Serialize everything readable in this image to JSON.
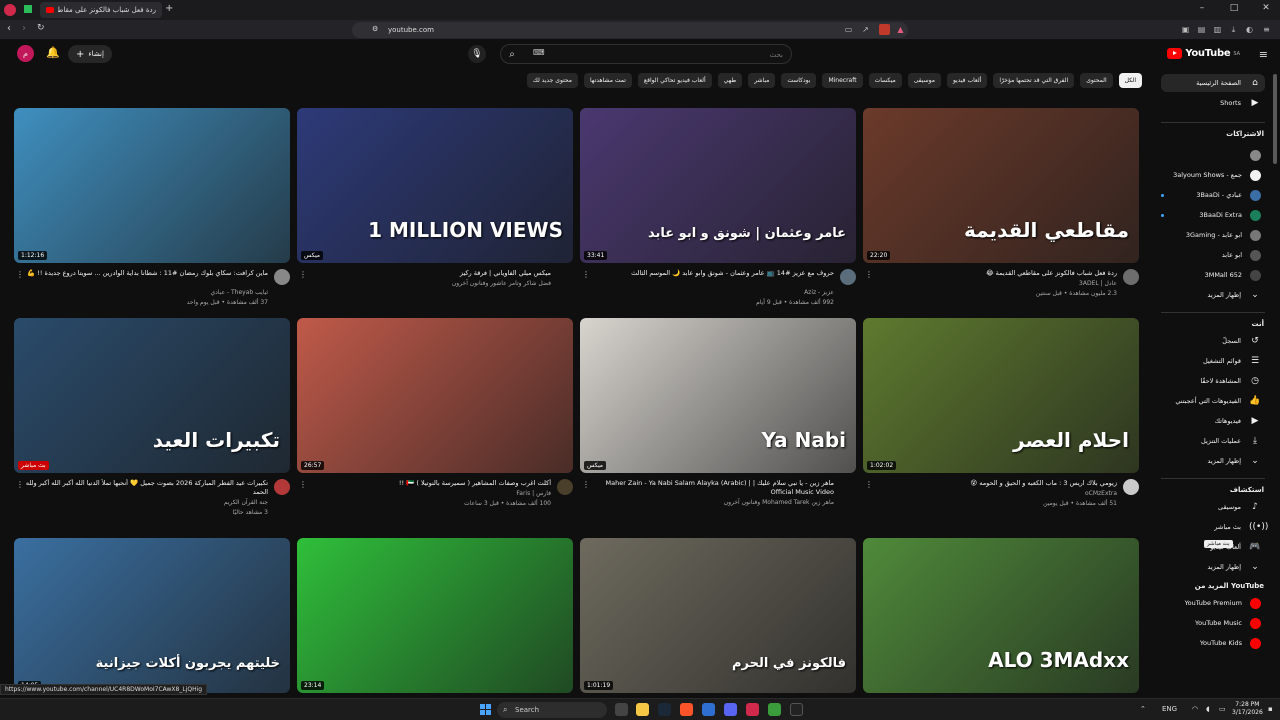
{
  "browser": {
    "tabs": [
      {
        "title": "ردة فعل شباب فالكونز على مقاطعي ا",
        "active": true
      }
    ],
    "url": "youtube.com",
    "new_tab": "+"
  },
  "header": {
    "logo_text": "YouTube",
    "logo_region": "SA",
    "search_placeholder": "بحث",
    "create_label": "إنشاء",
    "avatar_letter": "م"
  },
  "chips": [
    "الكل",
    "المحتوى",
    "الفرق التي قد تحتمها مؤخرًا",
    "ألعاب فيديو",
    "موسيقى",
    "ميكسات",
    "Minecraft",
    "بودكاست",
    "مباشر",
    "طهي",
    "ألعاب فيديو تحاكي الواقع",
    "تمت مشاهدتها",
    "محتوى جديد لك"
  ],
  "sidebar": {
    "main": [
      {
        "label": "الصفحة الرئيسية",
        "icon": "home-icon",
        "active": true
      },
      {
        "label": "Shorts",
        "icon": "shorts-icon",
        "active": false
      }
    ],
    "subscriptions_title": "الاشتراكات",
    "subscriptions": [
      {
        "label": "",
        "color": "#888888",
        "dot": false
      },
      {
        "label": "3alyoum Shows - جمع",
        "color": "#f2f2f2",
        "dot": false
      },
      {
        "label": "3BaaDi - عبادي",
        "color": "#3b6ea5",
        "dot": true
      },
      {
        "label": "3BaaDi Extra",
        "color": "#1a7f5a",
        "dot": true
      },
      {
        "label": "3Gaming - ابو عابد",
        "color": "#777777",
        "dot": false
      },
      {
        "label": "ابو عابد",
        "color": "#555555",
        "dot": false
      },
      {
        "label": "3MMall 652",
        "color": "#444444",
        "dot": false
      }
    ],
    "subs_more": "إظهار المزيد",
    "you_title": "أنت",
    "you": [
      {
        "label": "السجلّ",
        "icon": "history-icon"
      },
      {
        "label": "قوائم التشغيل",
        "icon": "playlists-icon"
      },
      {
        "label": "المشاهدة لاحقًا",
        "icon": "watch-later-icon"
      },
      {
        "label": "الفيديوهات التي أعجبتني",
        "icon": "like-icon"
      },
      {
        "label": "فيديوهاتك",
        "icon": "your-videos-icon"
      },
      {
        "label": "عمليات التنزيل",
        "icon": "download-icon"
      }
    ],
    "you_more": "إظهار المزيد",
    "explore_title": "استكشاف",
    "explore": [
      {
        "label": "موسيقى",
        "icon": "music-icon"
      },
      {
        "label": "بث مباشر",
        "icon": "live-icon"
      },
      {
        "label": "ألعاب فيديو",
        "icon": "gaming-icon"
      }
    ],
    "explore_more": "إظهار المزيد",
    "more_title": "المزيد من YouTube",
    "more": [
      {
        "label": "YouTube Premium",
        "color": "#ff0000"
      },
      {
        "label": "YouTube Music",
        "color": "#ff0000"
      },
      {
        "label": "YouTube Kids",
        "color": "#ff0000"
      }
    ],
    "tooltip": "بث مباشر"
  },
  "videos": [
    {
      "title": "ردة فعل شباب فالكونز على مقاطعي القديمة 😂",
      "channel": "عادل | 3ADEL",
      "stats": "2.3 مليون مشاهدة • قبل سنتين",
      "duration": "22:20",
      "thumb_text": "مقاطعي القديمة",
      "bg": "#6b3a2a",
      "av": "#6d6d6d"
    },
    {
      "title": "حروف مع عزيز #14 📺 عامر وعثمان - شونق وابو عابد 🌙 الموسم الثالث",
      "channel": "عزيز - Aziz",
      "stats": "992 ألف مشاهدة • قبل 9 أيام",
      "duration": "33:41",
      "thumb_text": "عامر وعثمان | شونق و ابو عابد",
      "bg": "#4a3870",
      "av": "#5b6d7a"
    },
    {
      "title": "ميكس ميلي الفاوياني | فرقة ركيز",
      "channel": "فضل شاكر وتامر عاشور وفنانون آخرون",
      "stats": "",
      "duration": "ميكس",
      "thumb_text": "1 MILLION VIEWS",
      "bg": "#2d3a78",
      "av": ""
    },
    {
      "title": "ماين كرافت: سكاي بلوك رمضان #11 : شطانا بداية الوادرين ... سويتا دروع جديدة !! 💪",
      "channel": "ثيايب Theyab - عبادي",
      "stats": "37 ألف مشاهدة • قبل يوم واحد",
      "duration": "1:12:16",
      "thumb_text": "",
      "bg": "#3f8fbf",
      "av": "#888888"
    },
    {
      "title": "زيومي بلاك اريس 3 : ماب الكعبه و الحيق و الحومه 😵",
      "channel": "oCMzExtra",
      "stats": "51 ألف مشاهدة • قبل يومين",
      "duration": "1:02:02",
      "thumb_text": "احلام العصر",
      "bg": "#5e7a2f",
      "av": "#c9c9c9"
    },
    {
      "title": "ماهر زين - يا نبي سلام عليك | Maher Zain - Ya Nabi Salam Alayka (Arabic) | Official Music Video",
      "channel": "ماهر زين Mohamed Tarek وفنانون آخرون",
      "stats": "",
      "duration": "ميكس",
      "thumb_text": "Ya Nabi",
      "bg": "#d8d5cf",
      "av": ""
    },
    {
      "title": "أكلت اغرب وصفات المشاهير ( سميرسة بالنوتيلا ) 🇦🇪 !!",
      "channel": "فارس | Faris",
      "stats": "100 ألف مشاهدة • قبل 3 ساعات",
      "duration": "26:57",
      "thumb_text": "",
      "bg": "#c05a4a",
      "av": "#4a3f2a"
    },
    {
      "title": "تكبيرات عيد الفطر المباركة 2026 بصوت جميل 💛 أنحبها تملأ الدنيا الله أكبر الله أكبر ولله الحمد",
      "channel": "جنة القرآن الكريم",
      "stats": "3 مشاهد حاليًا",
      "duration": "بث مباشر",
      "thumb_text": "تكبيرات العيد",
      "bg": "#2a4b6b",
      "av": "#b33939"
    },
    {
      "title": "",
      "channel": "",
      "stats": "",
      "duration": "",
      "thumb_text": "ALO 3MAdxx",
      "bg": "#4f8a3a",
      "av": ""
    },
    {
      "title": "",
      "channel": "",
      "stats": "",
      "duration": "1:01:19",
      "thumb_text": "فالكونز في الحرم",
      "bg": "#6e6a5e",
      "av": ""
    },
    {
      "title": "",
      "channel": "",
      "stats": "",
      "duration": "23:14",
      "thumb_text": "",
      "bg": "#2fbf3a",
      "av": ""
    },
    {
      "title": "",
      "channel": "",
      "stats": "",
      "duration": "14:05",
      "thumb_text": "خليتهم يجربون أكلات جيزانية",
      "bg": "#3a6fa0",
      "av": ""
    }
  ],
  "status_url": "https://www.youtube.com/channel/UC4R8DWoMoI7CAwX8_LjQHig",
  "taskbar": {
    "search": "Search",
    "lang": "ENG",
    "time": "7:28 PM",
    "date": "3/17/2026"
  }
}
